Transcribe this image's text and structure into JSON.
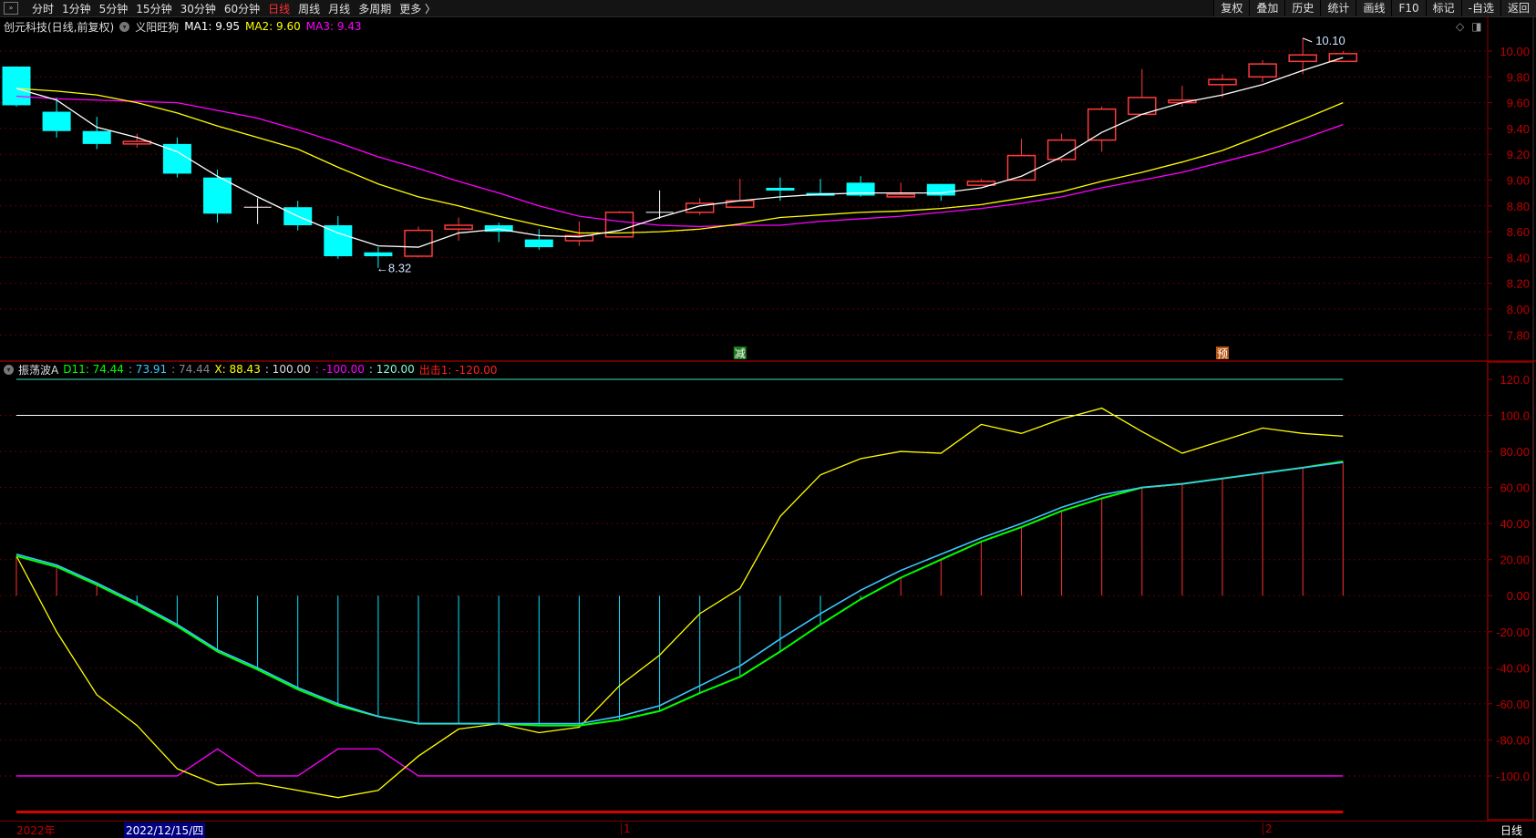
{
  "toolbar": {
    "periods": [
      "分时",
      "1分钟",
      "5分钟",
      "15分钟",
      "30分钟",
      "60分钟",
      "日线",
      "周线",
      "月线",
      "多周期",
      "更多 〉"
    ],
    "active_period": "日线",
    "right_buttons": [
      "复权",
      "叠加",
      "历史",
      "统计",
      "画线",
      "F10",
      "标记",
      "-自选",
      "返回"
    ]
  },
  "price_panel": {
    "title": "创元科技(日线,前复权)",
    "indicator_name": "义阳旺狗",
    "ma1": "MA1: 9.95",
    "ma2": "MA2: 9.60",
    "ma3": "MA3: 9.43",
    "high_label": "10.10",
    "low_label": "←8.32",
    "signal_reduce": "减",
    "signal_pre": "预",
    "y_ticks": [
      "10.00",
      "9.80",
      "9.60",
      "9.40",
      "9.20",
      "9.00",
      "8.80",
      "8.60",
      "8.40",
      "8.20",
      "8.00",
      "7.80"
    ]
  },
  "indicator_panel": {
    "name": "振荡波A",
    "d11": "D11: 74.44",
    "v2": ": 73.91",
    "v3": ": 74.44",
    "x": "X: 88.43",
    "v5": ": 100.00",
    "v6": ": -100.00",
    "v7": ": 120.00",
    "attack": "出击1: -120.00",
    "y_ticks": [
      "120.0",
      "100.0",
      "80.00",
      "60.00",
      "40.00",
      "20.00",
      "0.00",
      "-20.00",
      "-40.00",
      "-60.00",
      "-80.00",
      "-100.0"
    ]
  },
  "x_axis": {
    "year": "2022年",
    "cursor_date": "2022/12/15/四",
    "month1": "1",
    "month2": "2",
    "period_label": "日线"
  },
  "colors": {
    "up": "#ff3b3b",
    "down": "#00ffff",
    "ma1": "#ffffff",
    "ma2": "#ffff00",
    "ma3": "#ff00ff",
    "d11": "#00ff00",
    "d11b": "#3cc8ff",
    "x": "#ffff00",
    "axis": "#c00000"
  },
  "chart_data": {
    "type": "candlestick",
    "ylim": [
      7.8,
      10.0
    ],
    "ohlc": [
      [
        9.88,
        9.88,
        9.57,
        9.58
      ],
      [
        9.53,
        9.64,
        9.33,
        9.38
      ],
      [
        9.38,
        9.49,
        9.24,
        9.28
      ],
      [
        9.28,
        9.36,
        9.25,
        9.3
      ],
      [
        9.28,
        9.33,
        9.02,
        9.05
      ],
      [
        9.02,
        9.08,
        8.67,
        8.74
      ],
      [
        8.79,
        8.86,
        8.66,
        8.79
      ],
      [
        8.79,
        8.84,
        8.61,
        8.65
      ],
      [
        8.65,
        8.72,
        8.39,
        8.41
      ],
      [
        8.44,
        8.48,
        8.32,
        8.41
      ],
      [
        8.41,
        8.64,
        8.4,
        8.61
      ],
      [
        8.62,
        8.71,
        8.53,
        8.65
      ],
      [
        8.65,
        8.67,
        8.52,
        8.6
      ],
      [
        8.54,
        8.62,
        8.46,
        8.48
      ],
      [
        8.53,
        8.68,
        8.49,
        8.57
      ],
      [
        8.56,
        8.76,
        8.56,
        8.75
      ],
      [
        8.75,
        8.92,
        8.7,
        8.75
      ],
      [
        8.75,
        8.86,
        8.73,
        8.82
      ],
      [
        8.79,
        9.01,
        8.79,
        8.84
      ],
      [
        8.94,
        9.02,
        8.84,
        8.92
      ],
      [
        8.9,
        9.01,
        8.88,
        8.88
      ],
      [
        8.98,
        9.03,
        8.87,
        8.88
      ],
      [
        8.87,
        8.98,
        8.87,
        8.89
      ],
      [
        8.97,
        8.97,
        8.84,
        8.88
      ],
      [
        8.96,
        9.01,
        8.96,
        8.99
      ],
      [
        9.0,
        9.32,
        9.0,
        9.19
      ],
      [
        9.16,
        9.36,
        9.14,
        9.31
      ],
      [
        9.31,
        9.57,
        9.22,
        9.55
      ],
      [
        9.51,
        9.86,
        9.51,
        9.64
      ],
      [
        9.6,
        9.73,
        9.57,
        9.62
      ],
      [
        9.74,
        9.82,
        9.64,
        9.78
      ],
      [
        9.8,
        9.93,
        9.76,
        9.9
      ],
      [
        9.92,
        10.1,
        9.82,
        9.97
      ],
      [
        9.92,
        10.0,
        9.92,
        9.98
      ]
    ],
    "ma1": [
      9.71,
      9.62,
      9.41,
      9.33,
      9.22,
      9.03,
      8.87,
      8.72,
      8.59,
      8.49,
      8.48,
      8.59,
      8.62,
      8.57,
      8.56,
      8.61,
      8.71,
      8.8,
      8.84,
      8.87,
      8.89,
      8.9,
      8.9,
      8.9,
      8.94,
      9.03,
      9.18,
      9.37,
      9.51,
      9.6,
      9.66,
      9.74,
      9.85,
      9.95
    ],
    "ma2": [
      9.71,
      9.69,
      9.66,
      9.6,
      9.52,
      9.42,
      9.33,
      9.24,
      9.1,
      8.97,
      8.87,
      8.8,
      8.72,
      8.65,
      8.59,
      8.59,
      8.6,
      8.62,
      8.66,
      8.71,
      8.73,
      8.75,
      8.76,
      8.78,
      8.81,
      8.86,
      8.91,
      8.99,
      9.06,
      9.14,
      9.23,
      9.35,
      9.47,
      9.6
    ],
    "ma3": [
      9.65,
      9.63,
      9.62,
      9.61,
      9.6,
      9.54,
      9.48,
      9.39,
      9.29,
      9.18,
      9.09,
      8.99,
      8.9,
      8.8,
      8.72,
      8.68,
      8.65,
      8.64,
      8.65,
      8.65,
      8.68,
      8.7,
      8.72,
      8.75,
      8.78,
      8.82,
      8.87,
      8.94,
      9.0,
      9.06,
      9.14,
      9.22,
      9.32,
      9.43
    ],
    "high_index": 32,
    "low_index": 9,
    "reduce_index": 18,
    "pre_index": 30,
    "indicator": {
      "ylim": [
        -120,
        120
      ],
      "d11": [
        22,
        16,
        6,
        -5,
        -17,
        -31,
        -41,
        -52,
        -61,
        -67,
        -71,
        -71,
        -71,
        -72,
        -72,
        -69,
        -64,
        -54,
        -45,
        -31,
        -16,
        -2,
        10,
        20,
        30,
        38,
        47,
        54,
        60,
        62,
        65,
        68,
        71,
        74.44
      ],
      "d11b": [
        23,
        17,
        7,
        -4,
        -16,
        -30,
        -40,
        -51,
        -60,
        -67,
        -71,
        -71,
        -71,
        -71,
        -71,
        -67,
        -61,
        -50,
        -39,
        -24,
        -10,
        3,
        14,
        23,
        32,
        40,
        49,
        56,
        60,
        62,
        65,
        68,
        71,
        73.91
      ],
      "x": [
        22,
        -20,
        -55,
        -72,
        -96,
        -105,
        -104,
        -108,
        -112,
        -108,
        -89,
        -74,
        -71,
        -76,
        -73,
        -50,
        -33,
        -10,
        4,
        44,
        67,
        76,
        80,
        79,
        95,
        90,
        98,
        104,
        91,
        79,
        86,
        93,
        90,
        88.43
      ],
      "m": [
        -100,
        -100,
        -100,
        -100,
        -100,
        -85,
        -100,
        -100,
        -85,
        -85,
        -100,
        -100,
        -100,
        -100,
        -100,
        -100,
        -100,
        -100,
        -100,
        -100,
        -100,
        -100,
        -100,
        -100,
        -100,
        -100,
        -100,
        -100,
        -100,
        -100,
        -100,
        -100,
        -100,
        -100
      ],
      "level_high": 120,
      "level_mid": 100,
      "level_low": -100,
      "attack": -120
    }
  }
}
